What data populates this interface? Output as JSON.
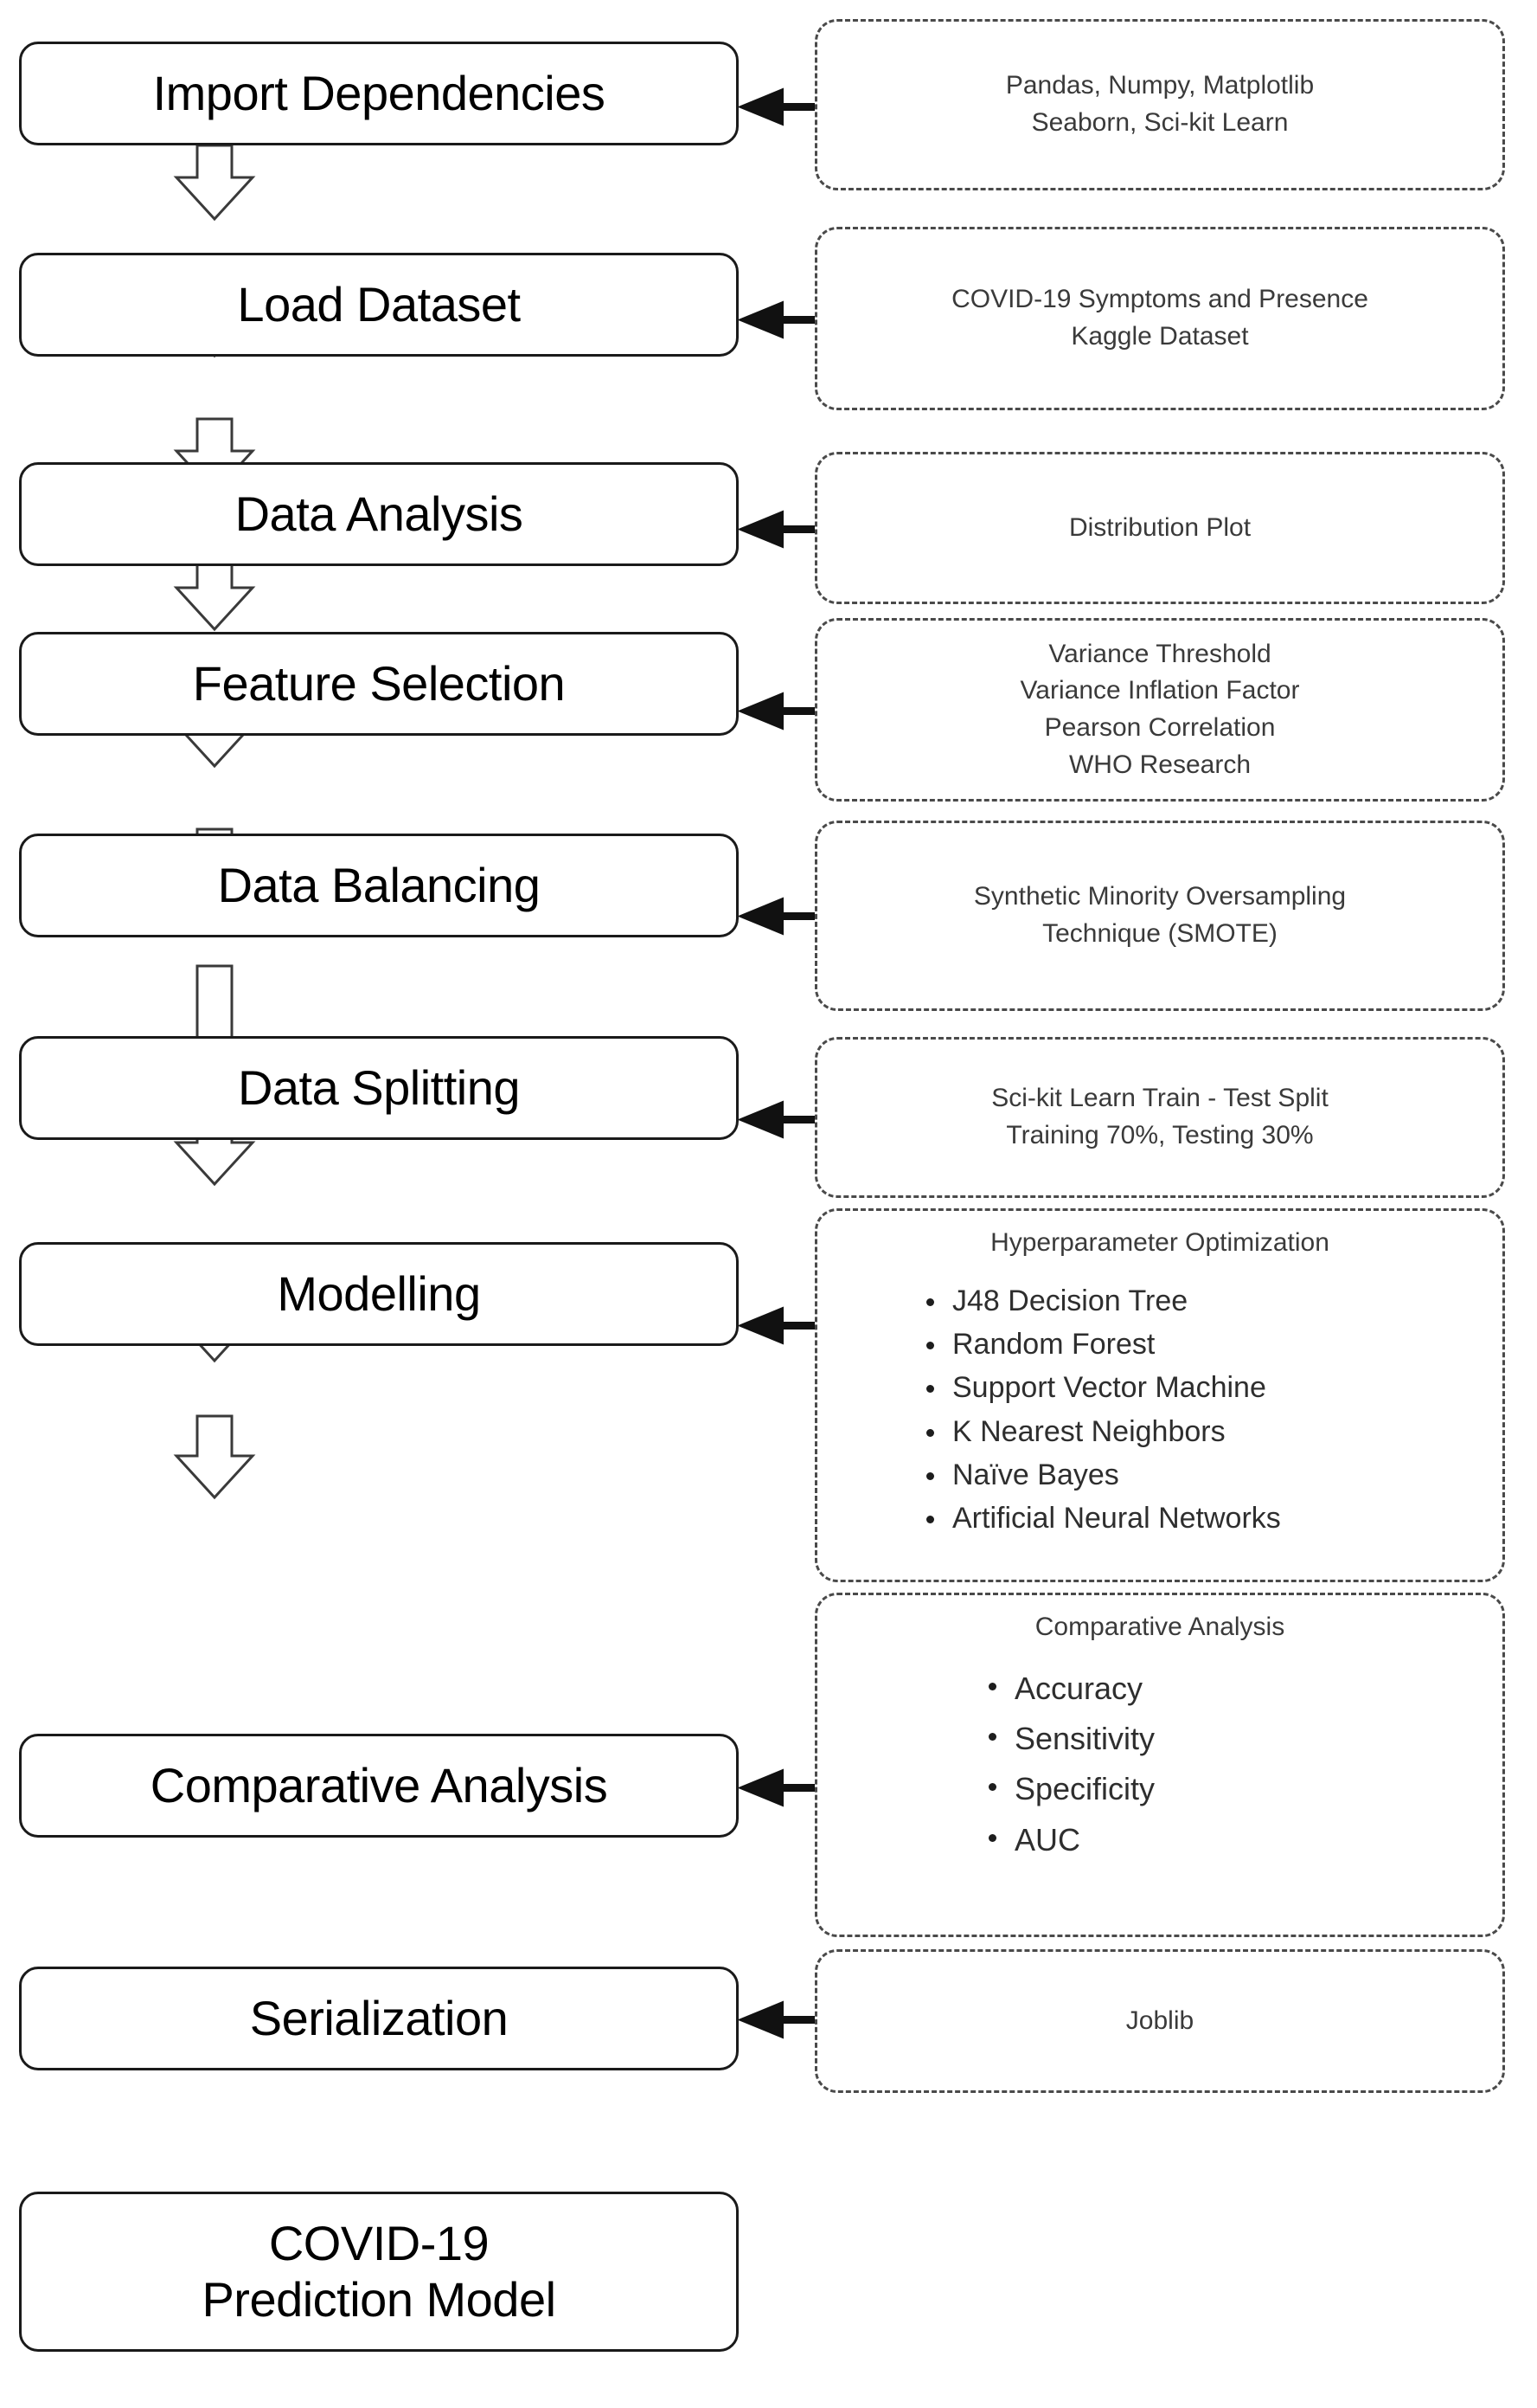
{
  "diagram": {
    "title": "COVID-19 Prediction Model Methodology Flowchart",
    "box_stroke": "#1a1a1a",
    "note_stroke": "#4a4a4a",
    "arrow_color": "#111111",
    "background": "#ffffff"
  },
  "steps": [
    {
      "id": "import-dependencies",
      "label": "Import Dependencies"
    },
    {
      "id": "load-dataset",
      "label": "Load Dataset"
    },
    {
      "id": "data-analysis",
      "label": "Data Analysis"
    },
    {
      "id": "feature-selection",
      "label": "Feature Selection"
    },
    {
      "id": "data-balancing",
      "label": "Data Balancing"
    },
    {
      "id": "data-splitting",
      "label": "Data Splitting"
    },
    {
      "id": "modelling",
      "label": "Modelling"
    },
    {
      "id": "comparative-analysis",
      "label": "Comparative Analysis"
    },
    {
      "id": "serialization",
      "label": "Serialization"
    },
    {
      "id": "covid-prediction-model",
      "label": "COVID-19",
      "label2": "Prediction Model"
    }
  ],
  "notes": {
    "dependencies": {
      "line1": "Pandas, Numpy, Matplotlib",
      "line2": "Seaborn, Sci-kit Learn"
    },
    "dataset": {
      "line1": "COVID-19 Symptoms and Presence",
      "line2": "Kaggle Dataset"
    },
    "analysis": {
      "line1": "Distribution Plot"
    },
    "feature_selection": {
      "line1": "Variance Threshold",
      "line2": "Variance Inflation Factor",
      "line3": "Pearson Correlation",
      "line4": "WHO Research"
    },
    "balancing": {
      "line1": "Synthetic Minority Oversampling",
      "line2": "Technique (SMOTE)"
    },
    "splitting": {
      "line1": "Sci-kit Learn Train - Test Split",
      "line2": "Training 70%, Testing 30%"
    },
    "modelling": {
      "title": "Hyperparameter Optimization",
      "items": [
        "J48 Decision Tree",
        "Random Forest",
        "Support Vector Machine",
        "K Nearest Neighbors",
        "Naïve Bayes",
        "Artificial Neural Networks"
      ]
    },
    "comparative": {
      "title": "Comparative Analysis",
      "items": [
        "Accuracy",
        "Sensitivity",
        "Specificity",
        "AUC"
      ]
    },
    "serialization": {
      "line1": "Joblib"
    }
  }
}
